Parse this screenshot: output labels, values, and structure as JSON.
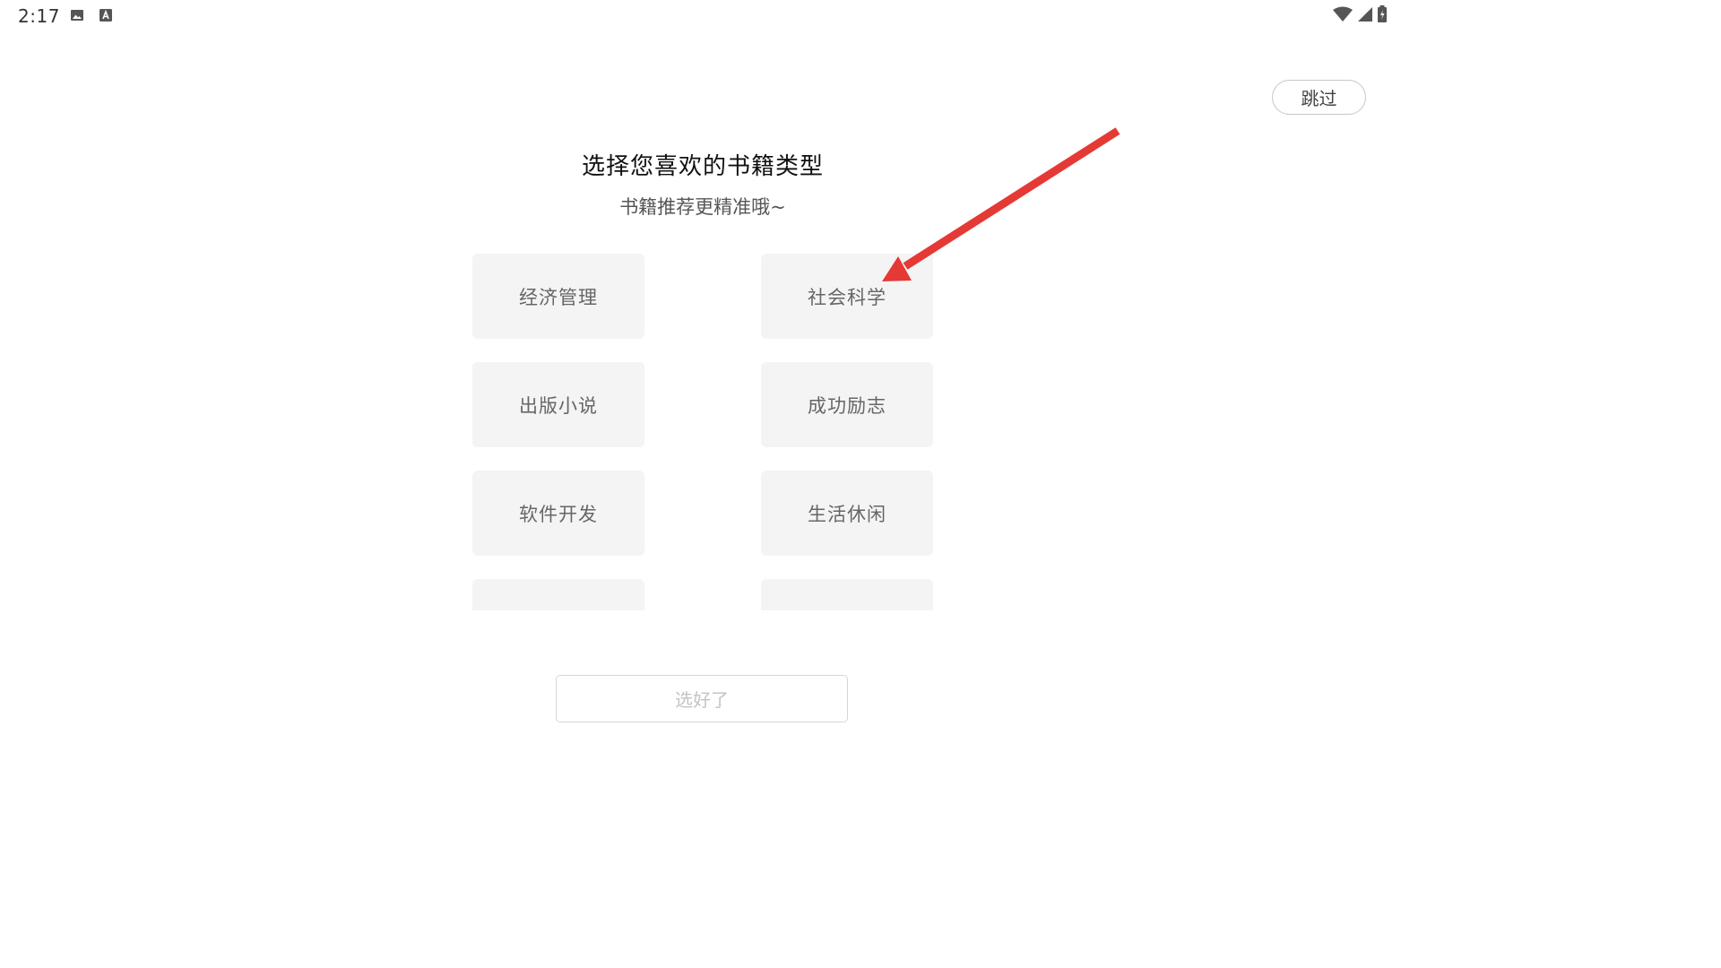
{
  "status_bar": {
    "time": "2:17",
    "left_icons": [
      "image-icon",
      "font-download-icon"
    ],
    "right_icons": [
      "wifi-icon",
      "cell-signal-icon",
      "battery-charging-icon"
    ]
  },
  "header": {
    "skip_label": "跳过"
  },
  "main": {
    "title": "选择您喜欢的书籍类型",
    "subtitle": "书籍推荐更精准哦~",
    "categories": [
      {
        "label": "经济管理"
      },
      {
        "label": "社会科学"
      },
      {
        "label": "出版小说"
      },
      {
        "label": "成功励志"
      },
      {
        "label": "软件开发"
      },
      {
        "label": "生活休闲"
      },
      {
        "label": ""
      },
      {
        "label": ""
      }
    ],
    "confirm_label": "选好了"
  },
  "annotation": {
    "arrow_color": "#e53935",
    "points_to": "社会科学"
  }
}
